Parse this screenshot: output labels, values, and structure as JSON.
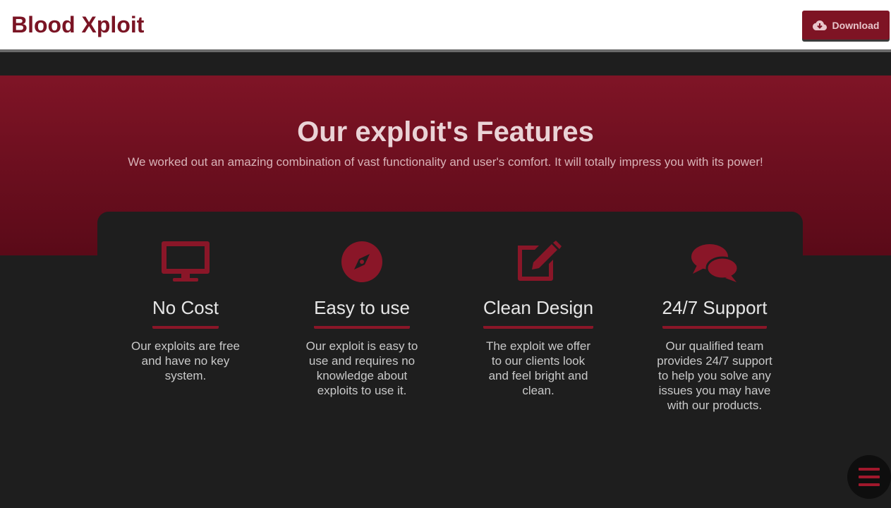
{
  "header": {
    "logo": "Blood Xploit",
    "download_label": "Download",
    "download_icon": "cloud-download-icon"
  },
  "hero": {
    "title": "Our exploit's Features",
    "subtitle": "We worked out an amazing combination of vast functionality and user's comfort. It will totally impress you with its power!"
  },
  "features": [
    {
      "icon": "monitor-icon",
      "title": "No Cost",
      "description": "Our exploits are free and have no key system."
    },
    {
      "icon": "compass-icon",
      "title": "Easy to use",
      "description": "Our exploit is easy to use and requires no knowledge about exploits to use it."
    },
    {
      "icon": "edit-icon",
      "title": "Clean Design",
      "description": "The exploit we offer to our clients look and feel bright and clean."
    },
    {
      "icon": "chat-bubbles-icon",
      "title": "24/7 Support",
      "description": "Our qualified team provides 24/7 support to help you solve any issues you may have with our products."
    }
  ],
  "menu": {
    "icon": "hamburger-menu-icon"
  },
  "colors": {
    "accent": "#7e1424",
    "background": "#1e1e1e",
    "hero_top": "#7f1426",
    "hero_bottom": "#5a0a18"
  }
}
